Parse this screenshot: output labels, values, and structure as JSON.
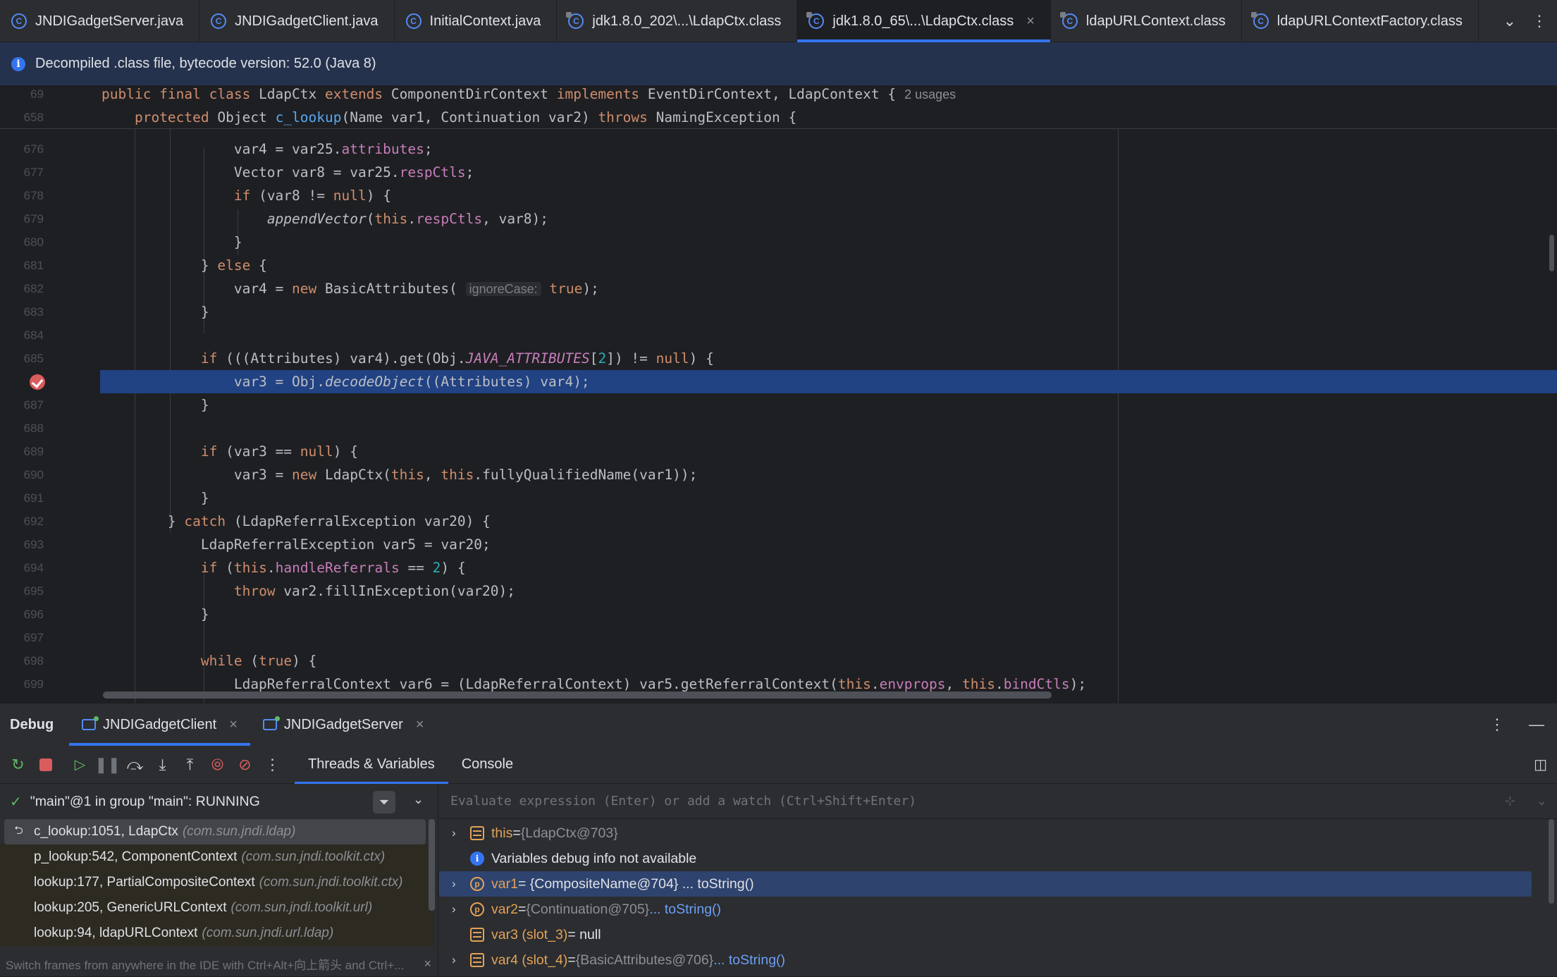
{
  "tabs": [
    {
      "label": "JNDIGadgetServer.java",
      "width": 290
    },
    {
      "label": "JNDIGadgetClient.java",
      "width": 284
    },
    {
      "label": "InitialContext.java",
      "width": 246
    },
    {
      "label": "jdk1.8.0_202\\...\\LdapCtx.class",
      "width": 340
    },
    {
      "label": "jdk1.8.0_65\\...\\LdapCtx.class",
      "width": 336
    },
    {
      "label": "ldapURLContext.class",
      "width": 280
    },
    {
      "label": "ldapURLContextFactory.class",
      "width": 340
    }
  ],
  "banner": {
    "text": "Decompiled .class file, bytecode version: 52.0 (Java 8)"
  },
  "sticky": {
    "l1_num": "69",
    "l1_usages": "2 usages",
    "l2_num": "658"
  },
  "lines": {
    "l675": "",
    "l676": "676",
    "l677": "677",
    "l678": "678",
    "l679": "679",
    "l680": "680",
    "l681": "681",
    "l682": "682",
    "l683": "683",
    "l684": "684",
    "l685": "685",
    "l687": "687",
    "l688": "688",
    "l689": "689",
    "l690": "690",
    "l691": "691",
    "l692": "692",
    "l693": "693",
    "l694": "694",
    "l695": "695",
    "l696": "696",
    "l697": "697",
    "l698": "698",
    "l699": "699",
    "hint_ignore_case": "ignoreCase:"
  },
  "debug": {
    "title": "Debug",
    "sessions": [
      "JNDIGadgetClient",
      "JNDIGadgetServer"
    ],
    "subtabs": [
      "Threads & Variables",
      "Console"
    ],
    "thread": "\"main\"@1 in group \"main\": RUNNING",
    "frames": [
      {
        "method": "c_lookup:1051, LdapCtx",
        "pkg": "(com.sun.jndi.ldap)"
      },
      {
        "method": "p_lookup:542, ComponentContext",
        "pkg": "(com.sun.jndi.toolkit.ctx)"
      },
      {
        "method": "lookup:177, PartialCompositeContext",
        "pkg": "(com.sun.jndi.toolkit.ctx)"
      },
      {
        "method": "lookup:205, GenericURLContext",
        "pkg": "(com.sun.jndi.toolkit.url)"
      },
      {
        "method": "lookup:94, ldapURLContext",
        "pkg": "(com.sun.jndi.url.ldap)"
      }
    ],
    "frames_tip": "Switch frames from anywhere in the IDE with Ctrl+Alt+向上箭头 and Ctrl+...",
    "eval_placeholder": "Evaluate expression (Enter) or add a watch (Ctrl+Shift+Enter)",
    "vars": {
      "this_name": "this",
      "this_eq": " = ",
      "this_val": "{LdapCtx@703}",
      "info": "Variables debug info not available",
      "var1_name": "var1",
      "var1_val": " = {CompositeName@704} ... toString()",
      "var2_name": "var2",
      "var2_eq": " = ",
      "var2_val": "{Continuation@705}",
      "var2_link": " ... toString()",
      "var3_name": "var3 (slot_3)",
      "var3_val": " = null",
      "var4_name": "var4 (slot_4)",
      "var4_eq": " = ",
      "var4_val": "{BasicAttributes@706}",
      "var4_link": " ... toString()"
    }
  },
  "colors": {
    "accent": "#3574f0",
    "selection": "#214283",
    "breakpoint": "#db5c5c",
    "keyword": "#cf8e6d"
  }
}
